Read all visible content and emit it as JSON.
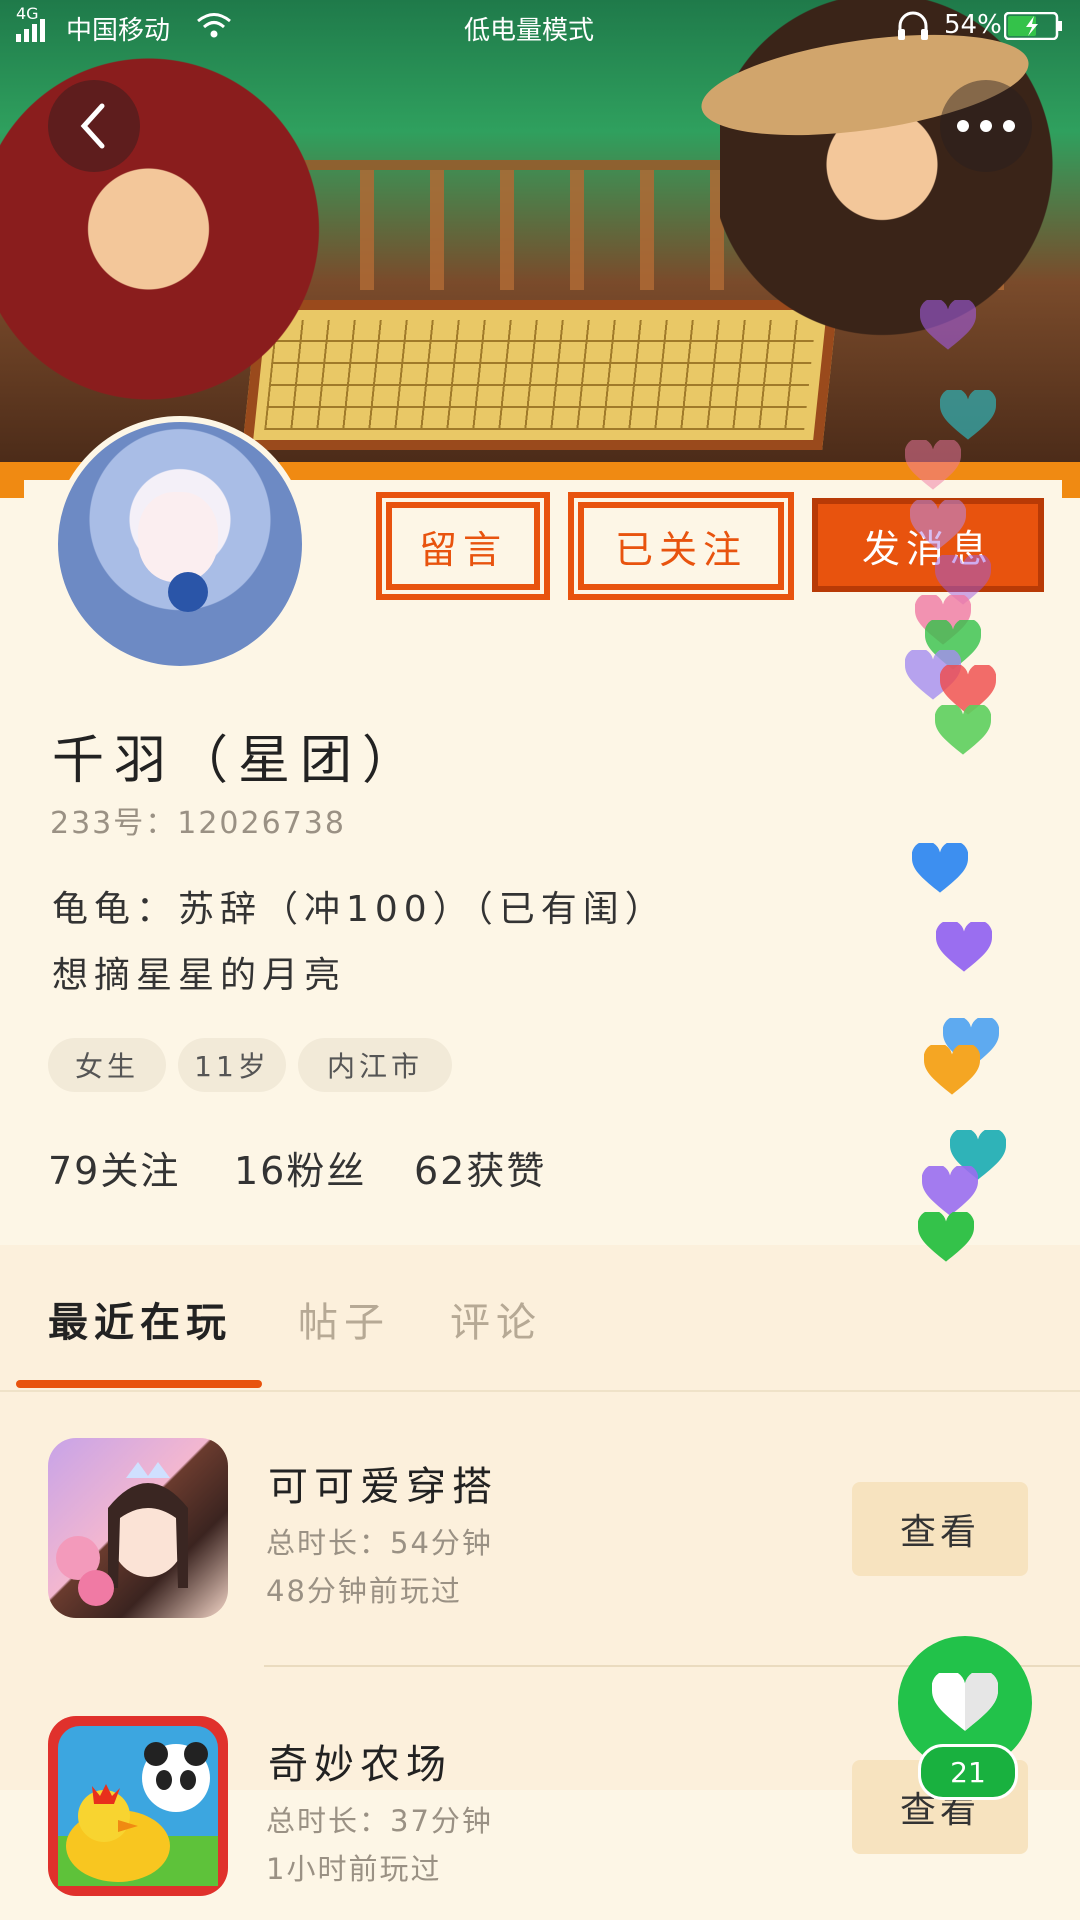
{
  "status_bar": {
    "network": "4G",
    "carrier": "中国移动",
    "mode": "低电量模式",
    "battery": "54%"
  },
  "profile": {
    "name": "千羽（星团）",
    "id_line": "233号：12026738",
    "bio_line_1": "龟龟：苏辞（冲100）（已有闺）",
    "bio_line_2": "想摘星星的月亮",
    "tags": [
      "女生",
      "11岁",
      "内江市"
    ],
    "stats": {
      "following": "79关注",
      "fans": "16粉丝",
      "likes": "62获赞"
    }
  },
  "actions": {
    "message_board": "留言",
    "followed": "已关注",
    "send_message": "发消息"
  },
  "tabs": [
    {
      "label": "最近在玩"
    },
    {
      "label": "帖子"
    },
    {
      "label": "评论"
    }
  ],
  "games": [
    {
      "title": "可可爱穿搭",
      "duration": "总时长：54分钟",
      "last_played": "48分钟前玩过",
      "button": "查看"
    },
    {
      "title": "奇妙农场",
      "duration": "总时长：37分钟",
      "last_played": "1小时前玩过",
      "button": "查看"
    }
  ],
  "like_fab": {
    "count": "21"
  },
  "colors": {
    "accent": "#e8530e",
    "background": "#fdf6e6",
    "like_green": "#22c24a"
  },
  "icons": {
    "back": "back-chevron-icon",
    "more": "more-dots-icon",
    "like": "heart-icon"
  }
}
